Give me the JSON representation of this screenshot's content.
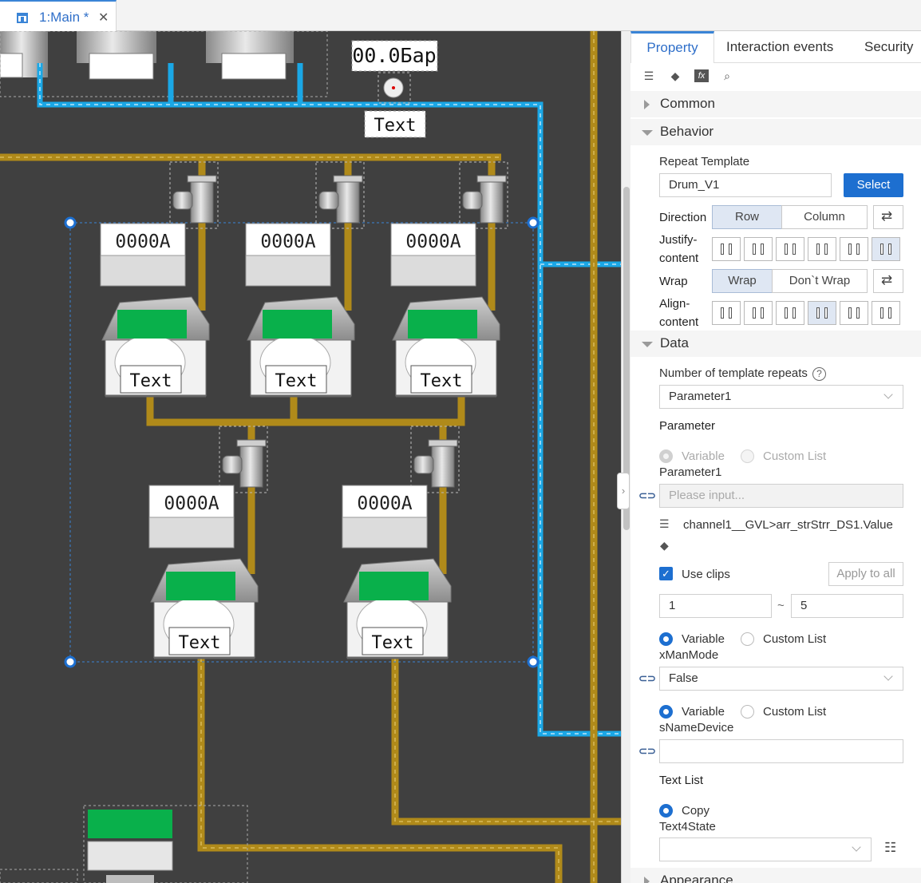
{
  "tab": {
    "title": "1:Main *",
    "close": "✕"
  },
  "canvas": {
    "pressure_value": "00.0Бар",
    "pressure_caption": "Text",
    "drums_row1": [
      {
        "value": "0000A",
        "caption": "Text"
      },
      {
        "value": "0000A",
        "caption": "Text"
      },
      {
        "value": "0000A",
        "caption": "Text"
      }
    ],
    "drums_row2": [
      {
        "value": "0000A",
        "caption": "Text"
      },
      {
        "value": "0000A",
        "caption": "Text"
      }
    ],
    "colors": {
      "background": "#404040",
      "pipe_yellow": "#b08a1a",
      "pipe_blue": "#1aa7e6",
      "status_green": "#09b04b"
    }
  },
  "panel": {
    "tabs": [
      "Property",
      "Interaction events",
      "Security"
    ],
    "active_tab": "Property",
    "toolbar_icons": [
      "list-icon",
      "tag-icon",
      "fx-icon",
      "search-icon"
    ],
    "sections": {
      "common": "Common",
      "behavior": "Behavior",
      "data": "Data",
      "appearance": "Appearance"
    },
    "behavior": {
      "repeat_template_label": "Repeat Template",
      "repeat_template_value": "Drum_V1",
      "select_button": "Select",
      "direction_label": "Direction",
      "direction_row": "Row",
      "direction_column": "Column",
      "justify_label_1": "Justify-",
      "justify_label_2": "content",
      "wrap_label": "Wrap",
      "wrap_on": "Wrap",
      "wrap_off": "Don`t Wrap",
      "align_label_1": "Align-",
      "align_label_2": "content"
    },
    "data": {
      "repeats_label": "Number of template repeats",
      "repeats_help": "?",
      "repeats_value": "Parameter1",
      "parameter_heading": "Parameter",
      "param_variable": "Variable",
      "param_custom": "Custom List",
      "param_name": "Parameter1",
      "param_placeholder": "Please input...",
      "binding_path": "channel1__GVL>arr_strStrr_DS1.Value",
      "use_clips_label": "Use clips",
      "apply_all": "Apply to all",
      "clip_from": "1",
      "clip_sep": "~",
      "clip_to": "5",
      "mode_variable": "Variable",
      "mode_custom": "Custom List",
      "mode_name": "xManMode",
      "mode_value": "False",
      "name_variable": "Variable",
      "name_custom": "Custom List",
      "name_param": "sNameDevice",
      "name_value": "",
      "text_list_heading": "Text List",
      "copy_label": "Copy",
      "text4state": "Text4State",
      "text4state_value": ""
    }
  }
}
